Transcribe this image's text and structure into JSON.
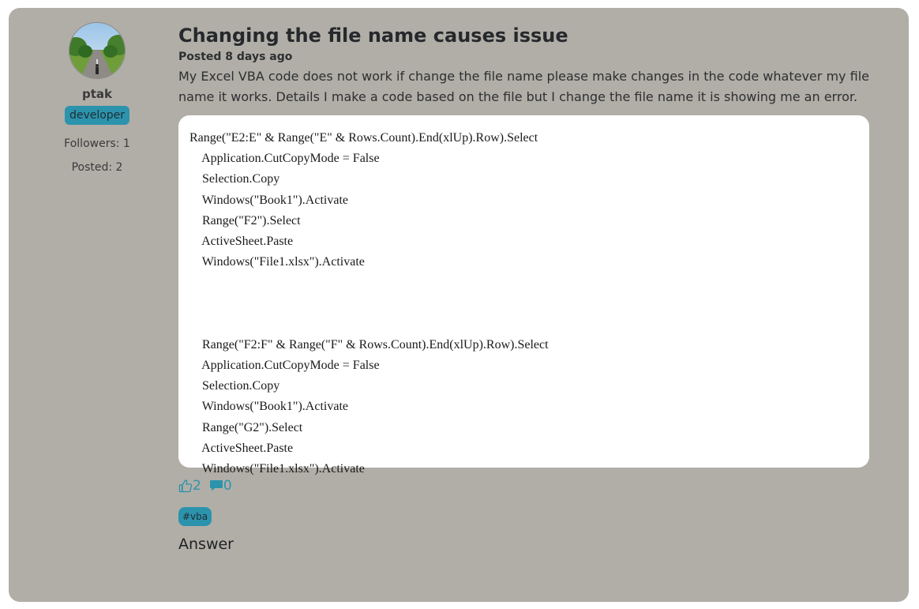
{
  "post": {
    "title": "Changing the file name causes issue",
    "meta": "Posted 8 days ago",
    "body": "My Excel VBA code does not work if change the file name please make changes in the code whatever my file name it works. Details I make a code based on the file but I change the file name it is showing me an error.",
    "code_lines": [
      "Range(\"E2:E\" & Range(\"E\" & Rows.Count).End(xlUp).Row).Select",
      "    Application.CutCopyMode = False",
      "    Selection.Copy",
      "    Windows(\"Book1\").Activate",
      "    Range(\"F2\").Select",
      "    ActiveSheet.Paste",
      "    Windows(\"File1.xlsx\").Activate",
      "",
      "",
      "",
      "    Range(\"F2:F\" & Range(\"F\" & Rows.Count).End(xlUp).Row).Select",
      "    Application.CutCopyMode = False",
      "    Selection.Copy",
      "    Windows(\"Book1\").Activate",
      "    Range(\"G2\").Select",
      "    ActiveSheet.Paste",
      "    Windows(\"File1.xlsx\").Activate"
    ],
    "likes": "2",
    "comments": "0",
    "tag": "#vba",
    "answer_label": "Answer"
  },
  "author": {
    "name": "ptak",
    "role": "developer",
    "followers": "Followers: 1",
    "posted": "Posted: 2",
    "avatar_icon": "avatar-photo-road"
  },
  "colors": {
    "card_bg": "#b1aea7",
    "accent": "#2c93ad",
    "code_bg": "#ffffff"
  }
}
